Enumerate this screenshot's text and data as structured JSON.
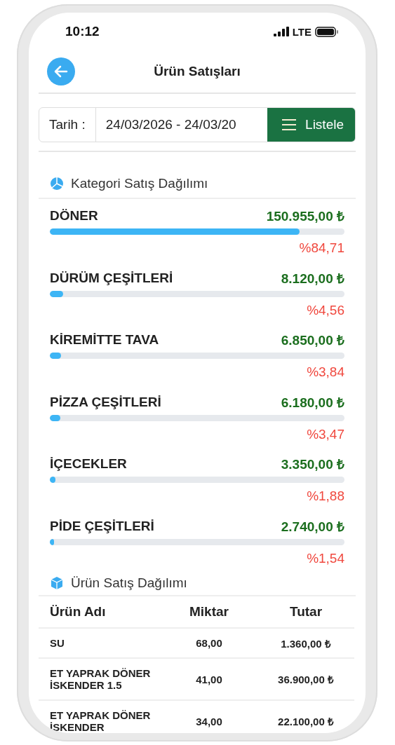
{
  "status_bar": {
    "time": "10:12",
    "network": "LTE"
  },
  "header": {
    "title": "Ürün Satışları"
  },
  "filter": {
    "label": "Tarih :",
    "value": "24/03/2026 - 24/03/20",
    "button": "Listele"
  },
  "category_section": {
    "title": "Kategori Satış Dağılımı",
    "items": [
      {
        "name": "DÖNER",
        "amount": "150.955,00 ₺",
        "percent": "%84,71",
        "level": 0.8471
      },
      {
        "name": "DÜRÜM ÇEŞİTLERİ",
        "amount": "8.120,00 ₺",
        "percent": "%4,56",
        "level": 0.0456
      },
      {
        "name": "KİREMİTTE TAVA",
        "amount": "6.850,00 ₺",
        "percent": "%3,84",
        "level": 0.0384
      },
      {
        "name": "PİZZA ÇEŞİTLERİ",
        "amount": "6.180,00 ₺",
        "percent": "%3,47",
        "level": 0.0347
      },
      {
        "name": "İÇECEKLER",
        "amount": "3.350,00 ₺",
        "percent": "%1,88",
        "level": 0.0188
      },
      {
        "name": "PİDE ÇEŞİTLERİ",
        "amount": "2.740,00 ₺",
        "percent": "%1,54",
        "level": 0.0154
      }
    ]
  },
  "product_section": {
    "title": "Ürün Satış Dağılımı",
    "columns": [
      "Ürün Adı",
      "Miktar",
      "Tutar"
    ],
    "rows": [
      {
        "name": "SU",
        "quantity": "68,00",
        "amount": "1.360,00 ₺"
      },
      {
        "name": "ET YAPRAK DÖNER İSKENDER 1.5",
        "quantity": "41,00",
        "amount": "36.900,00 ₺"
      },
      {
        "name": "ET YAPRAK DÖNER İSKENDER",
        "quantity": "34,00",
        "amount": "22.100,00 ₺"
      }
    ]
  }
}
